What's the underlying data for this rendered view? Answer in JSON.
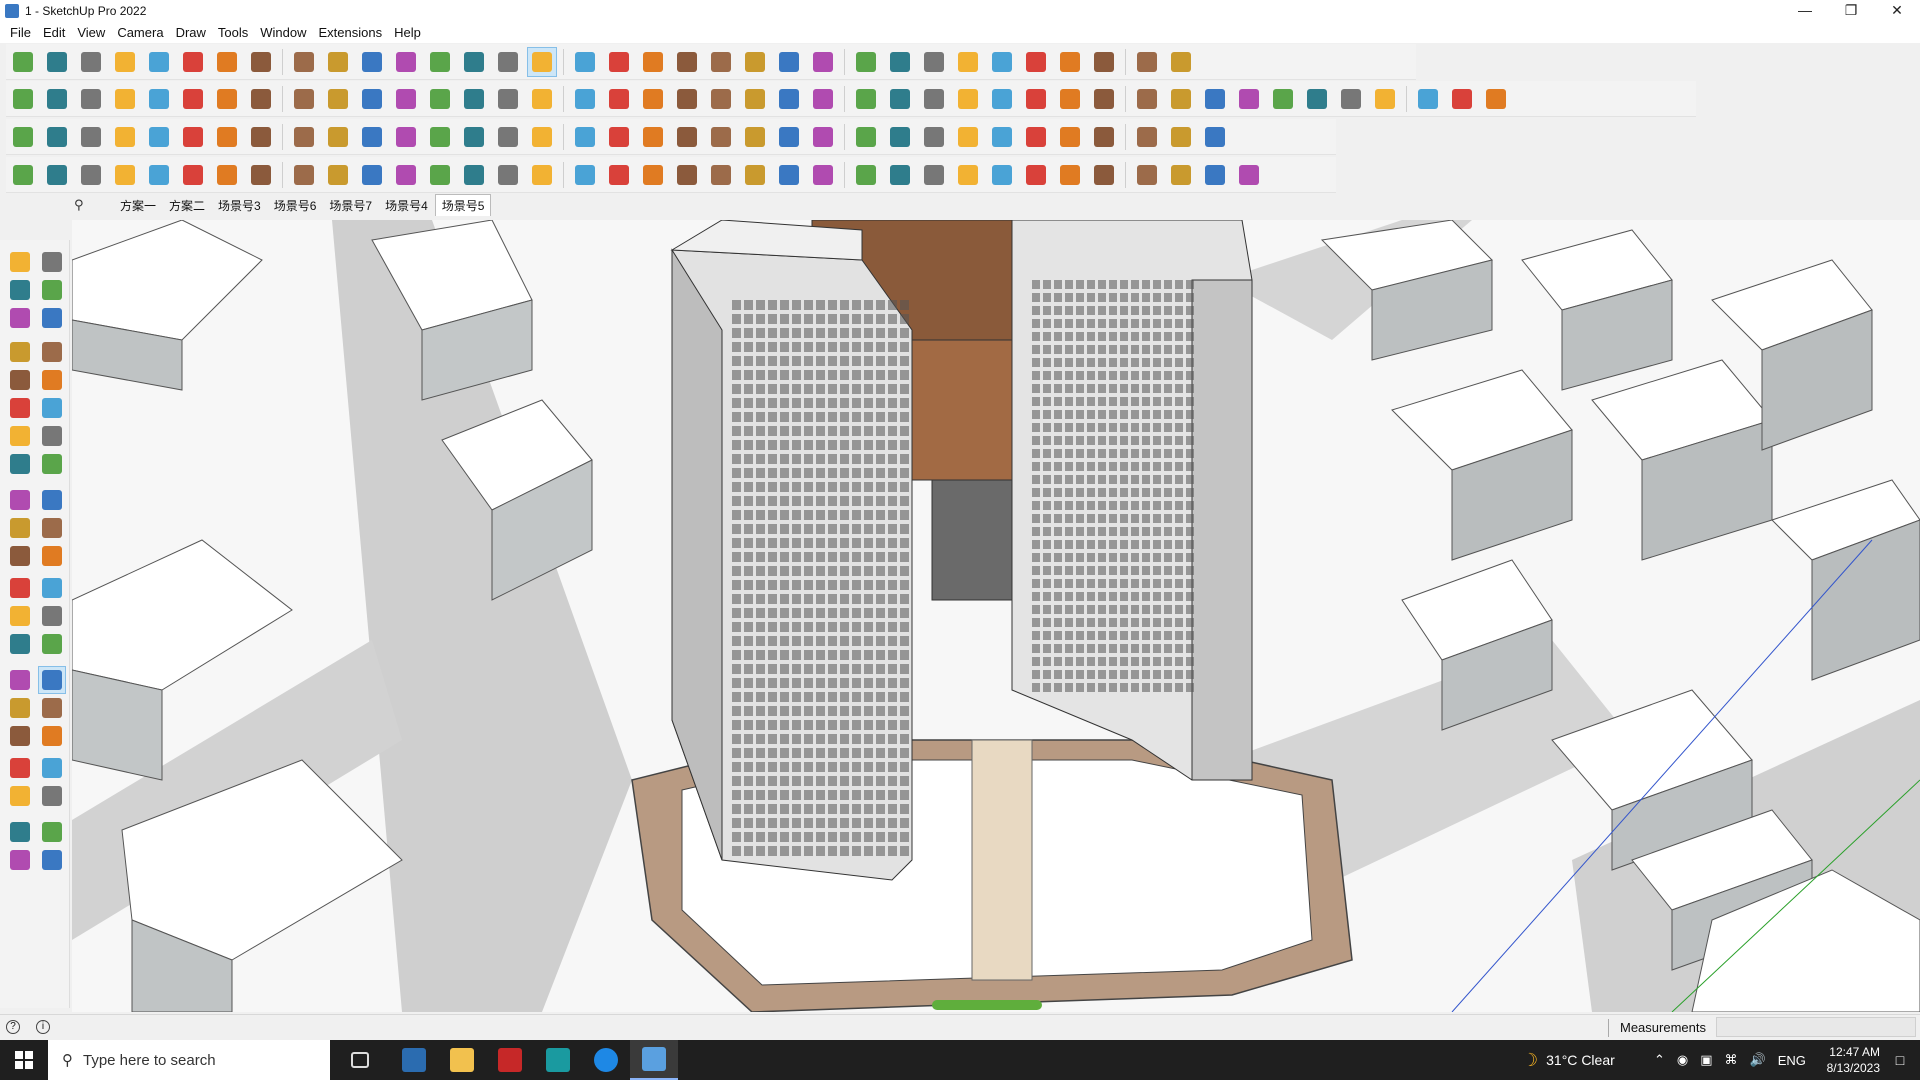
{
  "window": {
    "title": "1 - SketchUp Pro 2022",
    "controls": [
      "minimize-icon",
      "restore-icon",
      "close-icon"
    ]
  },
  "menu": [
    "File",
    "Edit",
    "View",
    "Camera",
    "Draw",
    "Tools",
    "Window",
    "Extensions",
    "Help"
  ],
  "scenes": {
    "tabs": [
      "方案一",
      "方案二",
      "场景号3",
      "场景号6",
      "场景号7",
      "场景号4",
      "场景号5"
    ],
    "active_index": 6
  },
  "status": {
    "measurements_label": "Measurements",
    "measurements_value": ""
  },
  "taskbar": {
    "search_placeholder": "Type here to search",
    "weather_temp": "31°C",
    "weather_text": "Clear",
    "language": "ENG",
    "time": "12:47 AM",
    "date": "8/13/2023"
  },
  "colors": {
    "accent": "#86bfe8",
    "taskbar_bg": "#1f1f1f",
    "viewport_bg": "#f6f6f6"
  }
}
